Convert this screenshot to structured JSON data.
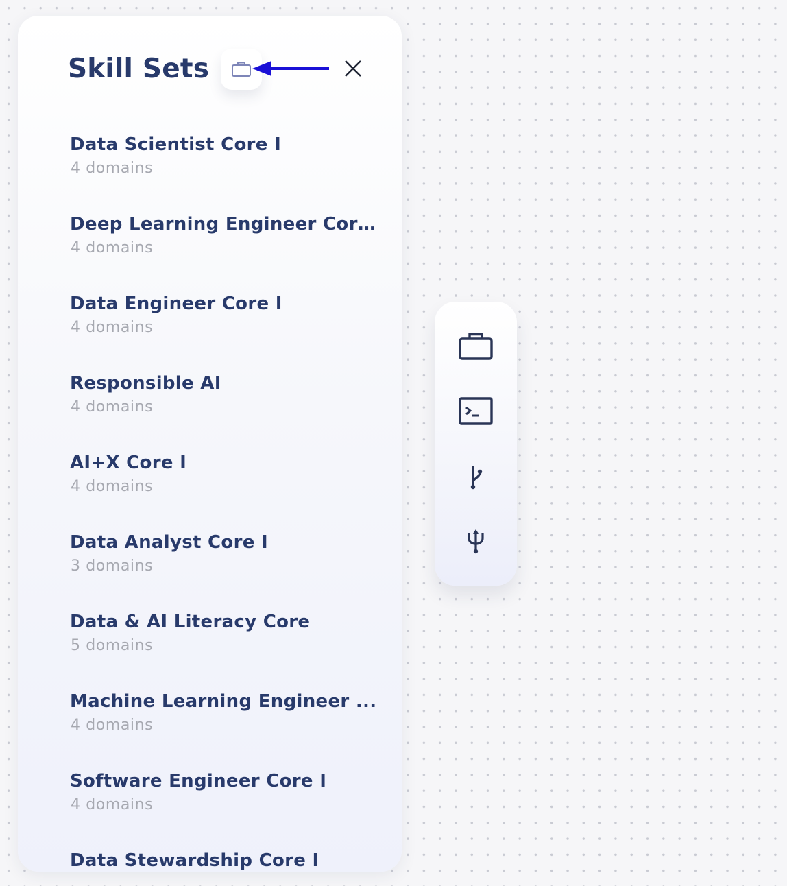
{
  "panel": {
    "title": "Skill Sets",
    "header_icon": "briefcase-icon",
    "close_icon": "close-icon"
  },
  "annotation": {
    "arrow_color": "#1a10d6"
  },
  "skill_sets": [
    {
      "name": "Data Scientist Core I",
      "domains": "4 domains"
    },
    {
      "name": "Deep Learning Engineer Core I",
      "domains": "4 domains"
    },
    {
      "name": "Data Engineer Core I",
      "domains": "4 domains"
    },
    {
      "name": "Responsible AI",
      "domains": "4 domains"
    },
    {
      "name": "AI+X Core I",
      "domains": "4 domains"
    },
    {
      "name": "Data Analyst Core I",
      "domains": "3 domains"
    },
    {
      "name": "Data & AI Literacy Core",
      "domains": "5 domains"
    },
    {
      "name": "Machine Learning Engineer ...",
      "domains": "4 domains"
    },
    {
      "name": "Software Engineer Core I",
      "domains": "4 domains"
    },
    {
      "name": "Data Stewardship Core I",
      "domains": ""
    }
  ],
  "toolbar": {
    "items": [
      "briefcase-icon",
      "terminal-icon",
      "git-branch-icon",
      "usb-icon"
    ]
  },
  "colors": {
    "title": "#283a6b",
    "subtitle": "#a6a8b0",
    "icon": "#2a3556",
    "arrow": "#1a10d6"
  }
}
